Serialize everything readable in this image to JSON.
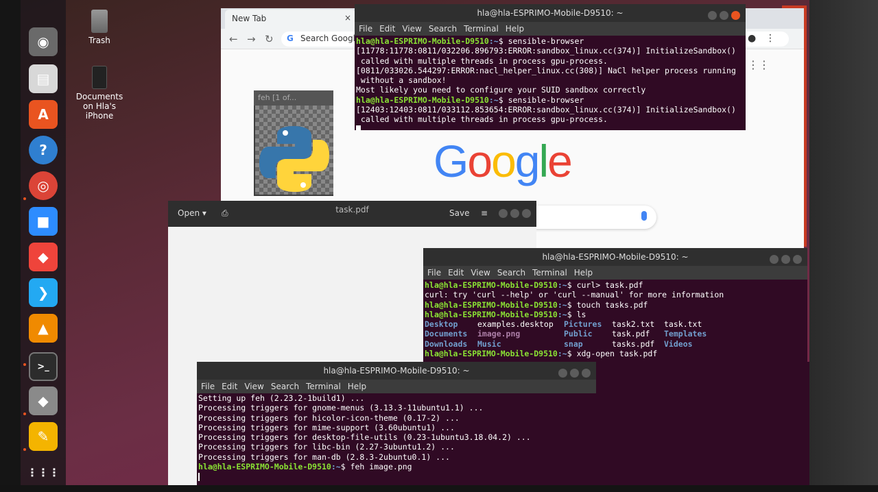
{
  "dock": {
    "items": [
      {
        "name": "speaker-icon",
        "glyph": "◉",
        "bg": "#6a6a6a"
      },
      {
        "name": "document-viewer-icon",
        "glyph": "▤",
        "bg": "#d8d8d8"
      },
      {
        "name": "software-center-icon",
        "glyph": "A",
        "bg": "#e95420"
      },
      {
        "name": "help-icon",
        "glyph": "?",
        "bg": "#2f7fd0"
      },
      {
        "name": "chrome-icon",
        "glyph": "◎",
        "bg": "#db4437"
      },
      {
        "name": "zoom-icon",
        "glyph": "■",
        "bg": "#2d8cff"
      },
      {
        "name": "anydesk-icon",
        "glyph": "◆",
        "bg": "#ef443b"
      },
      {
        "name": "vscode-icon",
        "glyph": "❯",
        "bg": "#23a9f2"
      },
      {
        "name": "vlc-icon",
        "glyph": "▲",
        "bg": "#f08a00"
      },
      {
        "name": "terminal-icon",
        "glyph": ">_",
        "bg": "#2c2c2c"
      },
      {
        "name": "installer-icon",
        "glyph": "◆",
        "bg": "#8a8a8a"
      },
      {
        "name": "text-editor-icon",
        "glyph": "✎",
        "bg": "#f4b400"
      },
      {
        "name": "show-apps-icon",
        "glyph": "⋮⋮⋮",
        "bg": "transparent"
      }
    ]
  },
  "desktop": {
    "trash_label": "Trash",
    "iphone_label_1": "Documents",
    "iphone_label_2": "on Hla's",
    "iphone_label_3": "iPhone"
  },
  "browser": {
    "tab_title": "New Tab",
    "tab_close": "×",
    "omnibox_text": "Search Google o",
    "google_letters": [
      "G",
      "o",
      "o",
      "g",
      "l",
      "e"
    ],
    "google_colors": [
      "#4285f4",
      "#ea4335",
      "#fbbc05",
      "#4285f4",
      "#34a853",
      "#ea4335"
    ]
  },
  "feh": {
    "title": "feh [1 of..."
  },
  "terminal_top": {
    "title": "hla@hla-ESPRIMO-Mobile-D9510: ~",
    "menu": [
      "File",
      "Edit",
      "View",
      "Search",
      "Terminal",
      "Help"
    ],
    "prompt_user": "hla@hla-ESPRIMO-Mobile-D9510",
    "prompt_path": ":~",
    "cmd1": "$ sensible-browser",
    "line1": "[11778:11778:0811/032206.896793:ERROR:sandbox_linux.cc(374)] InitializeSandbox()",
    "line2": " called with multiple threads in process gpu-process.",
    "line3": "[0811/033026.544297:ERROR:nacl_helper_linux.cc(308)] NaCl helper process running",
    "line4": " without a sandbox!",
    "line5": "Most likely you need to configure your SUID sandbox correctly",
    "cmd2": "$ sensible-browser",
    "line6": "[12403:12403:0811/033112.853654:ERROR:sandbox_linux.cc(374)] InitializeSandbox()",
    "line7": " called with multiple threads in process gpu-process."
  },
  "pdf": {
    "open_label": "Open",
    "open_caret": "▾",
    "title": "task.pdf",
    "save_label": "Save",
    "menu_glyph": "≡"
  },
  "terminal_right": {
    "title": "hla@hla-ESPRIMO-Mobile-D9510: ~",
    "menu": [
      "File",
      "Edit",
      "View",
      "Search",
      "Terminal",
      "Help"
    ],
    "prompt_user": "hla@hla-ESPRIMO-Mobile-D9510",
    "prompt_path": ":~",
    "cmd1": "$ curl> task.pdf",
    "out1": "curl: try 'curl --help' or 'curl --manual' for more information",
    "cmd2": "$ touch tasks.pdf",
    "cmd3": "$ ls",
    "ls_col1": [
      "Desktop",
      "Documents",
      "Downloads"
    ],
    "ls_col2": [
      "examples.desktop",
      "image.png",
      "Music"
    ],
    "ls_col3": [
      "Pictures",
      "Public",
      "snap"
    ],
    "ls_col4": [
      "task2.txt",
      "task.pdf",
      "tasks.pdf"
    ],
    "ls_col5": [
      "task.txt",
      "Templates",
      "Videos"
    ],
    "cmd4": "$ xdg-open task.pdf"
  },
  "terminal_bottom": {
    "title": "hla@hla-ESPRIMO-Mobile-D9510: ~",
    "menu": [
      "File",
      "Edit",
      "View",
      "Search",
      "Terminal",
      "Help"
    ],
    "line0": "Setting up feh (2.23.2-1build1) ...",
    "line1": "Processing triggers for gnome-menus (3.13.3-11ubuntu1.1) ...",
    "line2": "Processing triggers for hicolor-icon-theme (0.17-2) ...",
    "line3": "Processing triggers for mime-support (3.60ubuntu1) ...",
    "line4": "Processing triggers for desktop-file-utils (0.23-1ubuntu3.18.04.2) ...",
    "line5": "Processing triggers for libc-bin (2.27-3ubuntu1.2) ...",
    "line6": "Processing triggers for man-db (2.8.3-2ubuntu0.1) ...",
    "prompt_user": "hla@hla-ESPRIMO-Mobile-D9510",
    "prompt_path": ":~",
    "cmd": "$ feh image.png"
  }
}
